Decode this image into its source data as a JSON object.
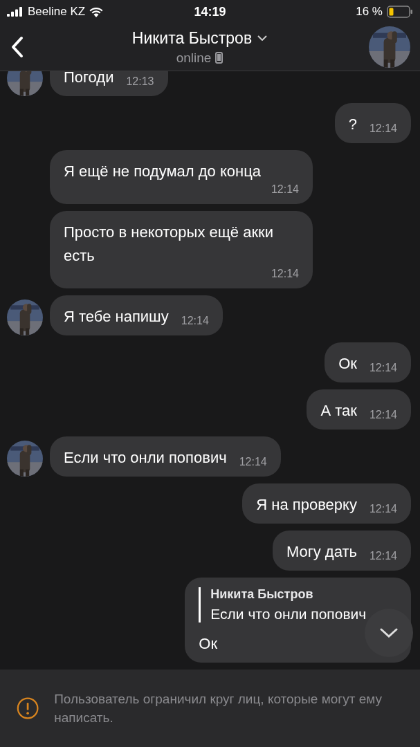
{
  "status_bar": {
    "carrier": "Beeline KZ",
    "time": "14:19",
    "battery": "16 %"
  },
  "header": {
    "title": "Никита Быстров",
    "subtitle": "online"
  },
  "messages": [
    {
      "kind": "in",
      "text": "Погоди",
      "time": "12:13",
      "avatar": true
    },
    {
      "kind": "out",
      "text": "?",
      "time": "12:14"
    },
    {
      "kind": "in",
      "text": "Я ещё не подумал до конца",
      "time": "12:14",
      "avatar": false
    },
    {
      "kind": "in",
      "text": "Просто в некоторых ещё акки есть",
      "time": "12:14",
      "avatar": false
    },
    {
      "kind": "in",
      "text": "Я тебе напишу",
      "time": "12:14",
      "avatar": true
    },
    {
      "kind": "out",
      "text": "Ок",
      "time": "12:14"
    },
    {
      "kind": "out",
      "text": "А так",
      "time": "12:14"
    },
    {
      "kind": "in",
      "text": "Если что онли попович",
      "time": "12:14",
      "avatar": true
    },
    {
      "kind": "out",
      "text": "Я на проверку",
      "time": "12:14"
    },
    {
      "kind": "out",
      "text": "Могу дать",
      "time": "12:14"
    },
    {
      "kind": "out",
      "text": "Ок",
      "reply": {
        "author": "Никита Быстров",
        "text": "Если что онли попович"
      }
    }
  ],
  "notice": "Пользователь ограничил круг лиц, которые могут ему написать."
}
